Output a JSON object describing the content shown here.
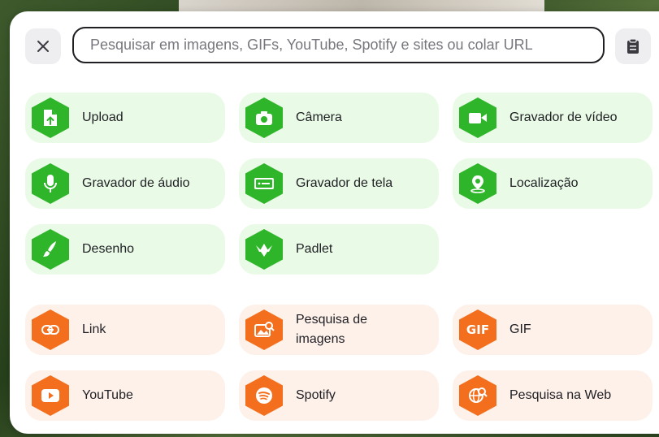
{
  "search": {
    "placeholder": "Pesquisar em imagens, GIFs, YouTube, Spotify e sites ou colar URL",
    "value": ""
  },
  "colors": {
    "green_icon": "#2fb52a",
    "green_tile": "#e9fbe6",
    "orange_icon": "#f36f1d",
    "orange_tile": "#fdf1ea"
  },
  "tiles": [
    {
      "label": "Upload",
      "icon": "upload-icon"
    },
    {
      "label": "Câmera",
      "icon": "camera-icon"
    },
    {
      "label": "Gravador de vídeo",
      "icon": "video-recorder-icon"
    },
    {
      "label": "Gravador de áudio",
      "icon": "microphone-icon"
    },
    {
      "label": "Gravador de tela",
      "icon": "screen-recorder-icon"
    },
    {
      "label": "Localização",
      "icon": "location-icon"
    },
    {
      "label": "Desenho",
      "icon": "brush-icon"
    },
    {
      "label": "Padlet",
      "icon": "padlet-icon"
    },
    {
      "label": "Link",
      "icon": "link-icon"
    },
    {
      "label": "Pesquisa de imagens",
      "icon": "image-search-icon"
    },
    {
      "label": "GIF",
      "icon": "gif-icon",
      "icon_text": "GIF"
    },
    {
      "label": "YouTube",
      "icon": "youtube-icon"
    },
    {
      "label": "Spotify",
      "icon": "spotify-icon"
    },
    {
      "label": "Pesquisa na Web",
      "icon": "web-search-icon"
    }
  ]
}
